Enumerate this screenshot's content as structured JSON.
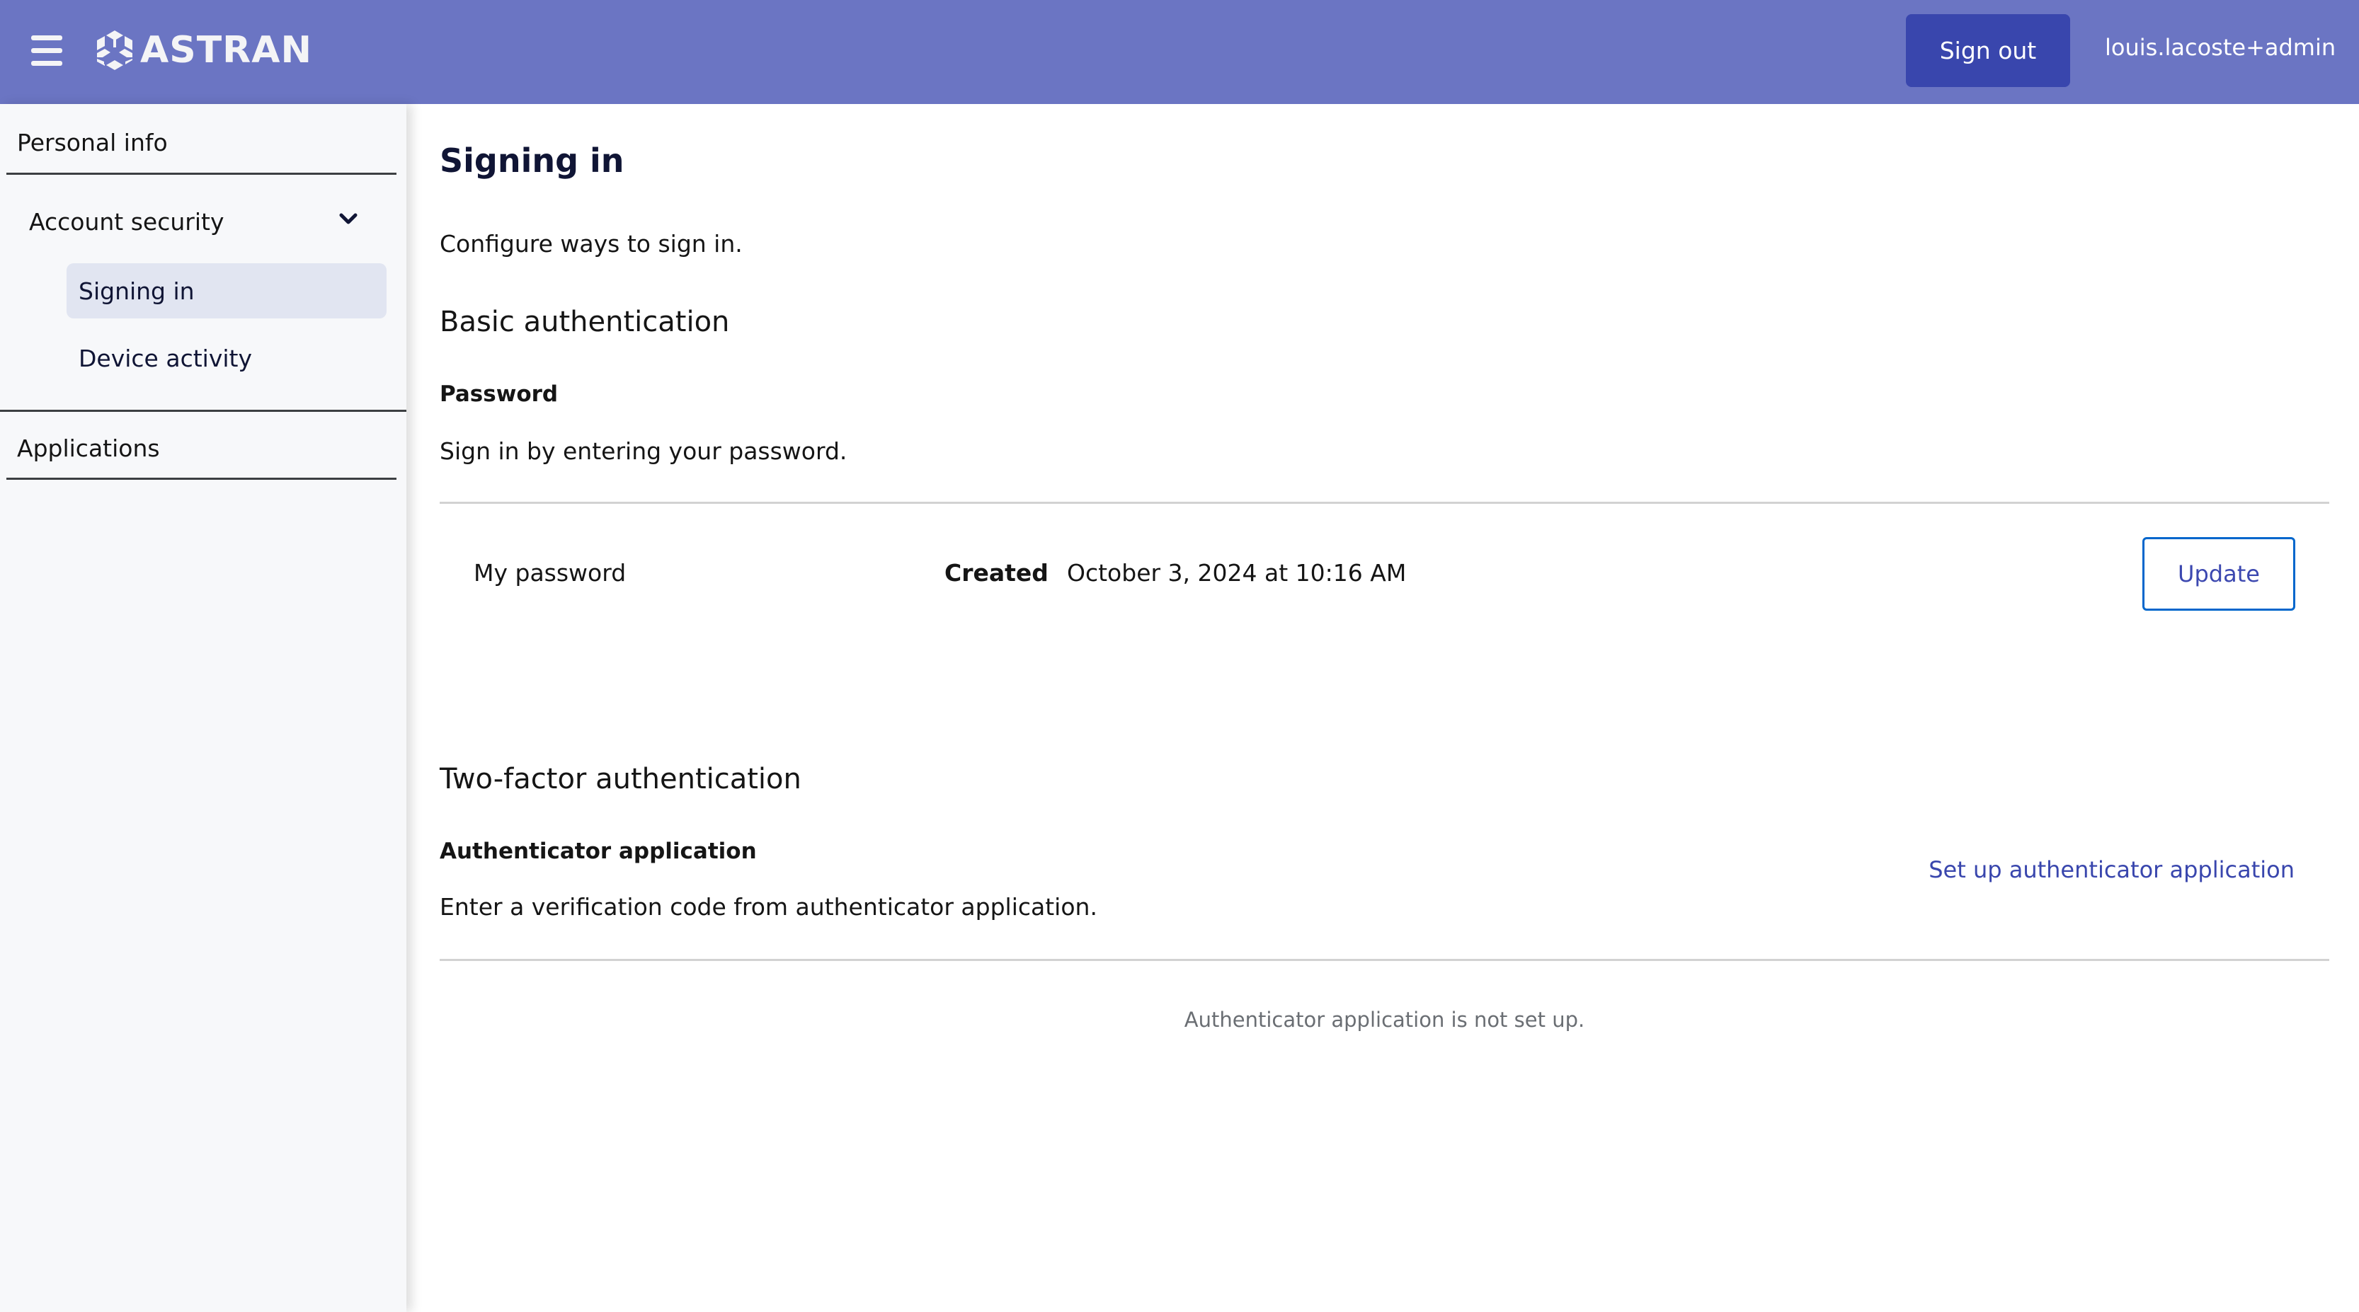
{
  "header": {
    "menu_icon": "hamburger-icon",
    "logo_icon": "astran-hexagon-logo",
    "logo_text": "ASTRAN",
    "sign_out_label": "Sign out",
    "username": "louis.lacoste+admin",
    "background_color": "#6b75c3",
    "button_color": "#3946ad"
  },
  "sidebar": {
    "items": [
      {
        "label": "Personal info"
      },
      {
        "label": "Account security",
        "expanded": true,
        "icon": "chevron-down-icon",
        "children": [
          {
            "label": "Signing in",
            "active": true
          },
          {
            "label": "Device activity",
            "active": false
          }
        ]
      },
      {
        "label": "Applications"
      }
    ]
  },
  "main": {
    "title": "Signing in",
    "description": "Configure ways to sign in.",
    "basic": {
      "title": "Basic authentication",
      "password_label": "Password",
      "password_description": "Sign in by entering your password.",
      "credential": {
        "name": "My password",
        "created_label": "Created",
        "created_value": "October 3, 2024 at 10:16 AM",
        "update_label": "Update"
      }
    },
    "two_factor": {
      "title": "Two-factor authentication",
      "otp_label": "Authenticator application",
      "otp_description": "Enter a verification code from authenticator application.",
      "setup_link": "Set up authenticator application",
      "empty_state": "Authenticator application is not set up."
    }
  }
}
